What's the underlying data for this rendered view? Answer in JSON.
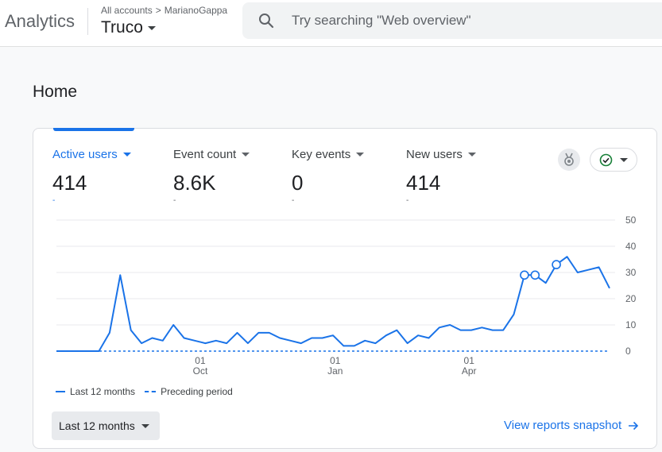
{
  "header": {
    "brand": "Analytics",
    "breadcrumb": {
      "root": "All accounts",
      "account": "MarianoGappa"
    },
    "property": "Truco",
    "search_placeholder": "Try searching \"Web overview\""
  },
  "page": {
    "title": "Home"
  },
  "metrics": [
    {
      "label": "Active users",
      "value": "414",
      "delta": "-",
      "active": true
    },
    {
      "label": "Event count",
      "value": "8.6K",
      "delta": "-",
      "active": false
    },
    {
      "label": "Key events",
      "value": "0",
      "delta": "-",
      "active": false
    },
    {
      "label": "New users",
      "value": "414",
      "delta": "-",
      "active": false
    }
  ],
  "colors": {
    "accent": "#1a73e8",
    "compare_check": "#188038"
  },
  "chart_data": {
    "type": "line",
    "x_tick_labels": [
      {
        "day": "01",
        "month": "Oct"
      },
      {
        "day": "01",
        "month": "Jan"
      },
      {
        "day": "01",
        "month": "Apr"
      }
    ],
    "y_ticks": [
      0,
      10,
      20,
      30,
      40,
      50
    ],
    "ylim": [
      0,
      50
    ],
    "series": [
      {
        "name": "Last 12 months",
        "style": "solid",
        "values": [
          0,
          0,
          0,
          0,
          0,
          7,
          29,
          8,
          3,
          5,
          4,
          10,
          5,
          4,
          3,
          4,
          3,
          7,
          3,
          7,
          7,
          5,
          4,
          3,
          5,
          5,
          6,
          2,
          2,
          4,
          3,
          6,
          8,
          3,
          6,
          5,
          9,
          10,
          8,
          8,
          9,
          8,
          8,
          14,
          29,
          29,
          26,
          33,
          36,
          30,
          31,
          32,
          24
        ],
        "markers": [
          44,
          45,
          47
        ]
      },
      {
        "name": "Preceding period",
        "style": "dashed",
        "values": [
          0,
          0,
          0,
          0,
          0,
          0,
          0,
          0,
          0,
          0,
          0,
          0,
          0,
          0,
          0,
          0,
          0,
          0,
          0,
          0,
          0,
          0,
          0,
          0,
          0,
          0,
          0,
          0,
          0,
          0,
          0,
          0,
          0,
          0,
          0,
          0,
          0,
          0,
          0,
          0,
          0,
          0,
          0,
          0,
          0,
          0,
          0,
          0,
          0,
          0,
          0,
          0,
          0
        ]
      }
    ],
    "legend_position": "bottom-left"
  },
  "footer": {
    "range_label": "Last 12 months",
    "link_label": "View reports snapshot"
  }
}
